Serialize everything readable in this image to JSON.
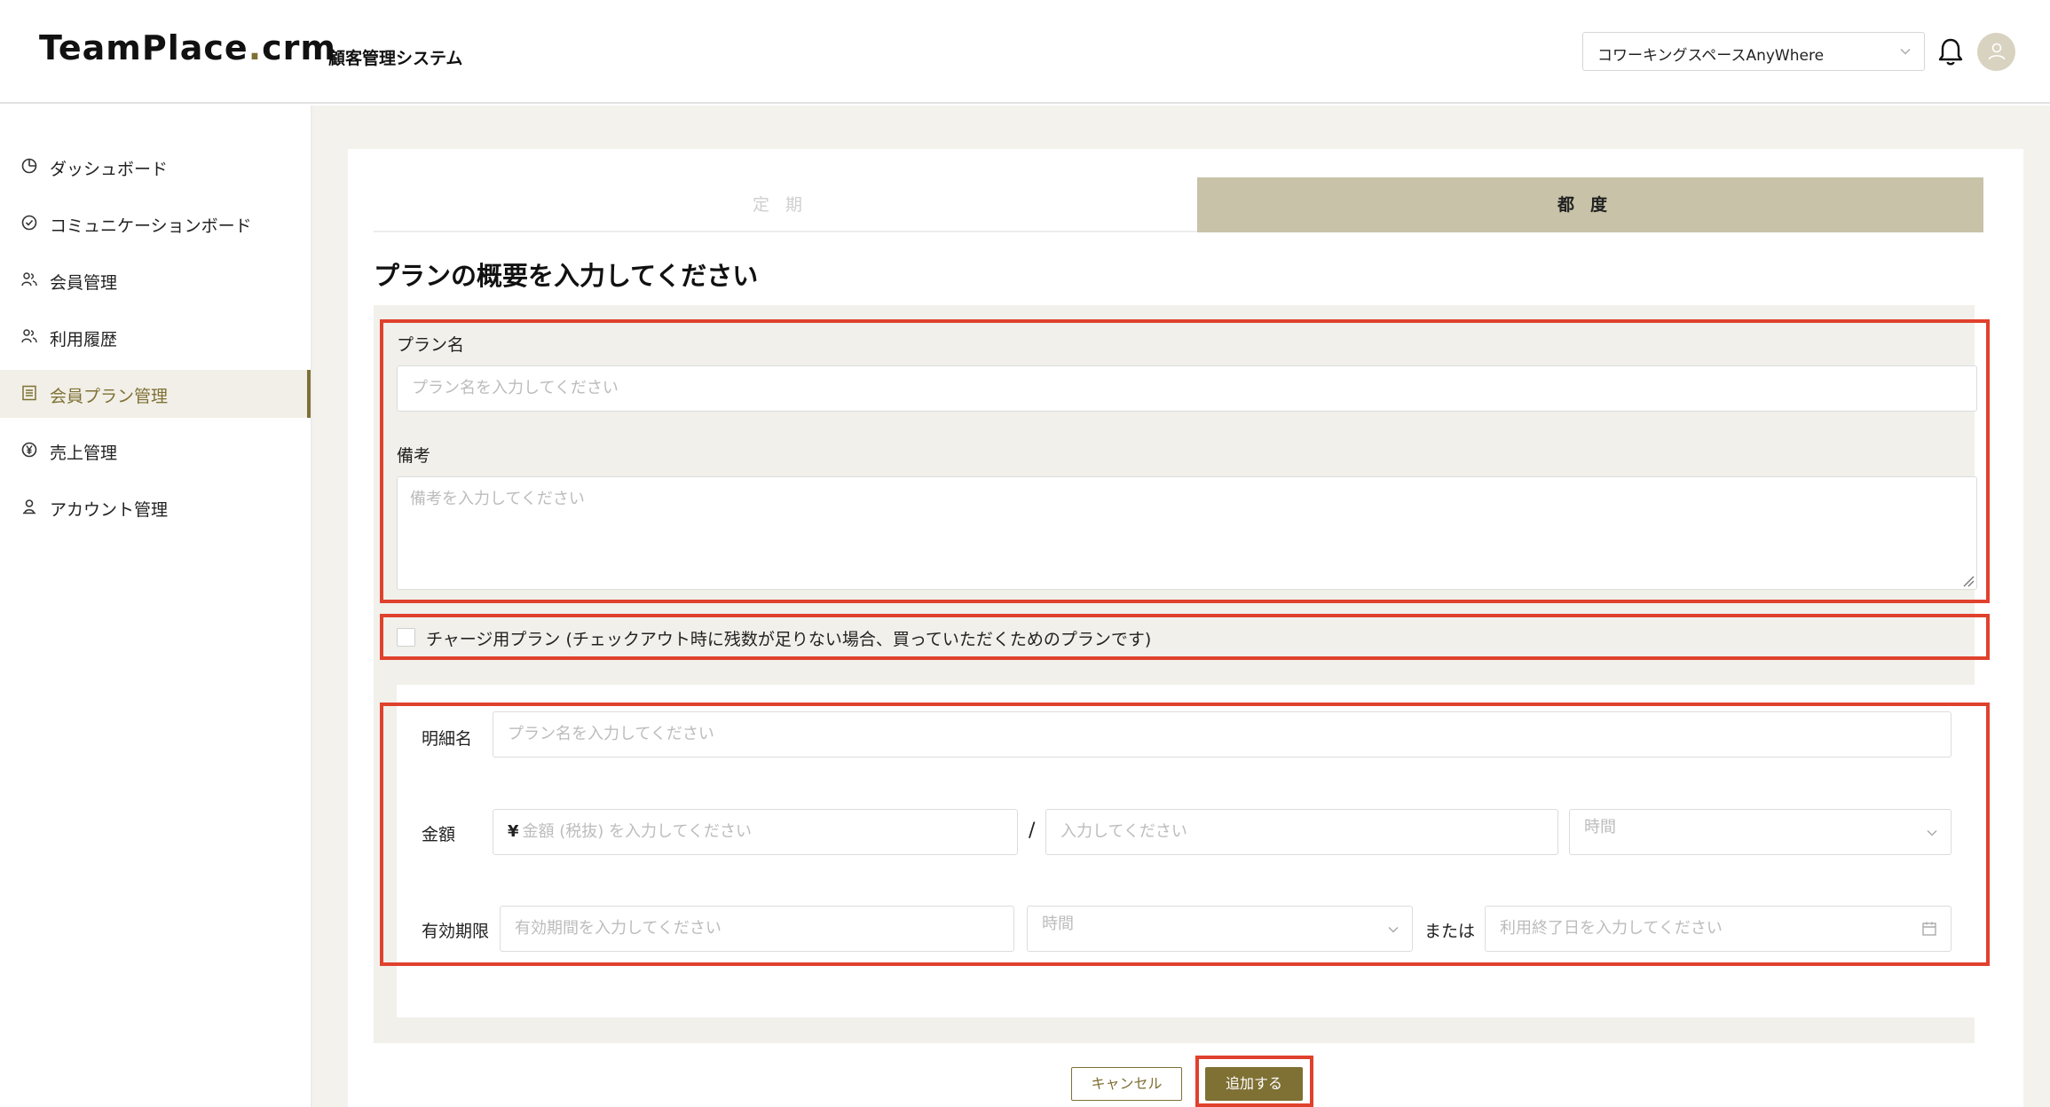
{
  "header": {
    "logo_main": "TeamPlace",
    "logo_dot": ".",
    "logo_suffix": "crm",
    "subtitle": "顧客管理システム",
    "workspace": "コワーキングスペースAnyWhere"
  },
  "sidebar": {
    "items": [
      {
        "label": "ダッシュボード",
        "icon": "dashboard-icon"
      },
      {
        "label": "コミュニケーションボード",
        "icon": "check-circle-icon"
      },
      {
        "label": "会員管理",
        "icon": "members-icon"
      },
      {
        "label": "利用履歴",
        "icon": "members-icon"
      },
      {
        "label": "会員プラン管理",
        "icon": "list-icon",
        "active": true
      },
      {
        "label": "売上管理",
        "icon": "yen-circle-icon"
      },
      {
        "label": "アカウント管理",
        "icon": "account-icon"
      }
    ]
  },
  "tabs": {
    "periodic": "定期",
    "each_time": "都度",
    "active": "each_time"
  },
  "main": {
    "title": "プランの概要を入力してください",
    "plan_name_label": "プラン名",
    "plan_name_placeholder": "プラン名を入力してください",
    "note_label": "備考",
    "note_placeholder": "備考を入力してください",
    "charge_plan_label": "チャージ用プラン (チェックアウト時に残数が足りない場合、買っていただくためのプランです)",
    "charge_plan_checked": false
  },
  "detail": {
    "item_name_label": "明細名",
    "item_name_placeholder": "プラン名を入力してください",
    "price_label": "金額",
    "currency": "¥",
    "price_placeholder": "金額 (税抜) を入力してください",
    "per_placeholder": "入力してください",
    "unit_placeholder": "時間",
    "expiry_label": "有効期限",
    "expiry_placeholder": "有効期間を入力してください",
    "expiry_unit_placeholder": "時間",
    "or_label": "または",
    "end_date_placeholder": "利用終了日を入力してください"
  },
  "buttons": {
    "cancel": "キャンセル",
    "add": "追加する"
  },
  "colors": {
    "accent": "#7f7034",
    "tab_active": "#c8c2a8",
    "highlight": "#e0412d",
    "content_bg": "#f3f2ed"
  }
}
